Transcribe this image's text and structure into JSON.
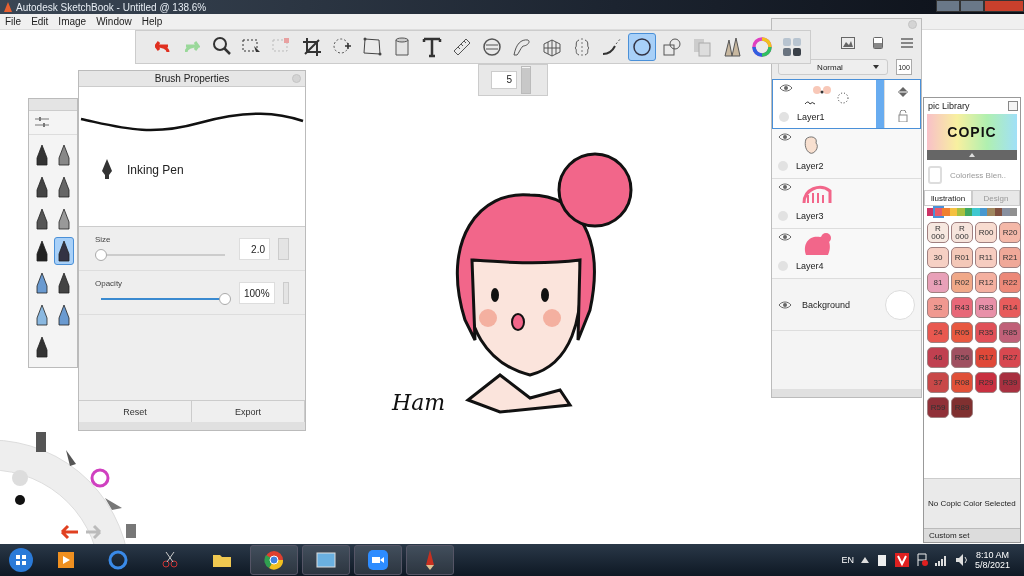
{
  "window": {
    "title": "Autodesk SketchBook - Untitled @ 138.6%"
  },
  "menu": [
    "File",
    "Edit",
    "Image",
    "Window",
    "Help"
  ],
  "toolbar": {
    "tools": [
      {
        "kind": "undo",
        "selected": false
      },
      {
        "kind": "redo",
        "selected": false
      },
      {
        "kind": "zoom",
        "selected": false
      },
      {
        "kind": "select",
        "selected": false
      },
      {
        "kind": "clear",
        "selected": false
      },
      {
        "kind": "crop",
        "selected": false
      },
      {
        "kind": "move",
        "selected": false
      },
      {
        "kind": "distort",
        "selected": false
      },
      {
        "kind": "fill",
        "selected": false
      },
      {
        "kind": "text",
        "selected": false
      },
      {
        "kind": "ruler",
        "selected": false
      },
      {
        "kind": "ellipse",
        "selected": false
      },
      {
        "kind": "curve",
        "selected": false
      },
      {
        "kind": "perspective",
        "selected": false
      },
      {
        "kind": "symmetry",
        "selected": false
      },
      {
        "kind": "stroke",
        "selected": false
      },
      {
        "kind": "circle",
        "selected": true
      },
      {
        "kind": "shape",
        "selected": false
      },
      {
        "kind": "copy",
        "selected": false
      },
      {
        "kind": "brushes",
        "selected": false
      },
      {
        "kind": "colorwheel",
        "selected": false
      },
      {
        "kind": "swatches",
        "selected": false
      }
    ]
  },
  "size_popup": {
    "value": "5",
    "level": 0.95
  },
  "brush_palette": {
    "brushes": [
      {
        "selected": false
      },
      {
        "selected": false
      },
      {
        "selected": false
      },
      {
        "selected": false
      },
      {
        "selected": false
      },
      {
        "selected": false
      },
      {
        "selected": false
      },
      {
        "selected": true
      },
      {
        "selected": false
      },
      {
        "selected": false
      },
      {
        "selected": false
      },
      {
        "selected": false
      },
      {
        "selected": false
      }
    ]
  },
  "brush_properties": {
    "title": "Brush Properties",
    "brush_name": "Inking Pen",
    "sliders": [
      {
        "label": "Size",
        "value": "2.0",
        "level": 0.0
      },
      {
        "label": "Opacity",
        "value": "100%",
        "level": 1.0
      }
    ],
    "buttons": [
      "Reset",
      "Export"
    ]
  },
  "canvas": {
    "signature": "Ham"
  },
  "layers": {
    "blend_mode": "Normal",
    "opacity": "100",
    "items": [
      {
        "name": "Layer1",
        "selected": true,
        "kind": "layer"
      },
      {
        "name": "Layer2",
        "selected": false,
        "kind": "layer"
      },
      {
        "name": "Layer3",
        "selected": false,
        "kind": "layer"
      },
      {
        "name": "Layer4",
        "selected": false,
        "kind": "layer"
      },
      {
        "name": "Background",
        "selected": false,
        "kind": "background"
      }
    ]
  },
  "copic": {
    "title": "pic Library",
    "logo": "COPIC",
    "blender": "Colorless Blen..",
    "tabs": [
      {
        "label": "llustration",
        "selected": true
      },
      {
        "label": "Design",
        "selected": false
      }
    ],
    "families": [
      {
        "color": "#cc3366",
        "selected": false
      },
      {
        "color": "#e85a6a",
        "selected": true
      },
      {
        "color": "#f08030",
        "selected": false
      },
      {
        "color": "#f5c040",
        "selected": false
      },
      {
        "color": "#a8c040",
        "selected": false
      },
      {
        "color": "#40a860",
        "selected": false
      },
      {
        "color": "#40c8d0",
        "selected": false
      },
      {
        "color": "#4898d0",
        "selected": false
      },
      {
        "color": "#a08860",
        "selected": false
      },
      {
        "color": "#805040",
        "selected": false
      },
      {
        "color": "#8890a0",
        "selected": false
      },
      {
        "color": "#909090",
        "selected": false
      }
    ],
    "swatches": [
      {
        "label": "R 000",
        "color": "#f6e8e0"
      },
      {
        "label": "R 000",
        "color": "#f6e4dc"
      },
      {
        "label": "R00",
        "color": "#f8dcd0"
      },
      {
        "label": "R20",
        "color": "#f4b8a8"
      },
      {
        "label": "30",
        "color": "#f6d0c4"
      },
      {
        "label": "R01",
        "color": "#f4c8b8"
      },
      {
        "label": "R11",
        "color": "#f6ccc0"
      },
      {
        "label": "R21",
        "color": "#f0a898"
      },
      {
        "label": "81",
        "color": "#e8a0b8"
      },
      {
        "label": "R02",
        "color": "#f0a888"
      },
      {
        "label": "R12",
        "color": "#f4b0a0"
      },
      {
        "label": "R22",
        "color": "#ec8878"
      },
      {
        "label": "32",
        "color": "#f09890"
      },
      {
        "label": "R43",
        "color": "#e86878"
      },
      {
        "label": "R83",
        "color": "#e890a8"
      },
      {
        "label": "R14",
        "color": "#e85c5c"
      },
      {
        "label": "24",
        "color": "#e85850"
      },
      {
        "label": "R05",
        "color": "#e85840"
      },
      {
        "label": "R35",
        "color": "#e05058"
      },
      {
        "label": "R85",
        "color": "#c06078"
      },
      {
        "label": "46",
        "color": "#c04050"
      },
      {
        "label": "R56",
        "color": "#a05060"
      },
      {
        "label": "R17",
        "color": "#e04838"
      },
      {
        "label": "R27",
        "color": "#d84850"
      },
      {
        "label": "37",
        "color": "#c84848"
      },
      {
        "label": "R08",
        "color": "#e05038"
      },
      {
        "label": "R29",
        "color": "#c83040"
      },
      {
        "label": "R39",
        "color": "#a83040"
      },
      {
        "label": "R59",
        "color": "#903038"
      },
      {
        "label": "R89",
        "color": "#803030"
      }
    ],
    "status": "No Copic Color Selected",
    "footer": "Custom set"
  },
  "taskbar": {
    "apps": [
      {
        "kind": "media",
        "selected": false
      },
      {
        "kind": "browser",
        "selected": false
      },
      {
        "kind": "snip",
        "selected": false
      },
      {
        "kind": "folder",
        "selected": false
      },
      {
        "kind": "chrome",
        "selected": true
      },
      {
        "kind": "photos",
        "selected": true
      },
      {
        "kind": "video",
        "selected": true
      },
      {
        "kind": "sketch",
        "selected": true
      }
    ],
    "language": "EN",
    "time": "8:10 AM",
    "date": "5/8/2021"
  }
}
